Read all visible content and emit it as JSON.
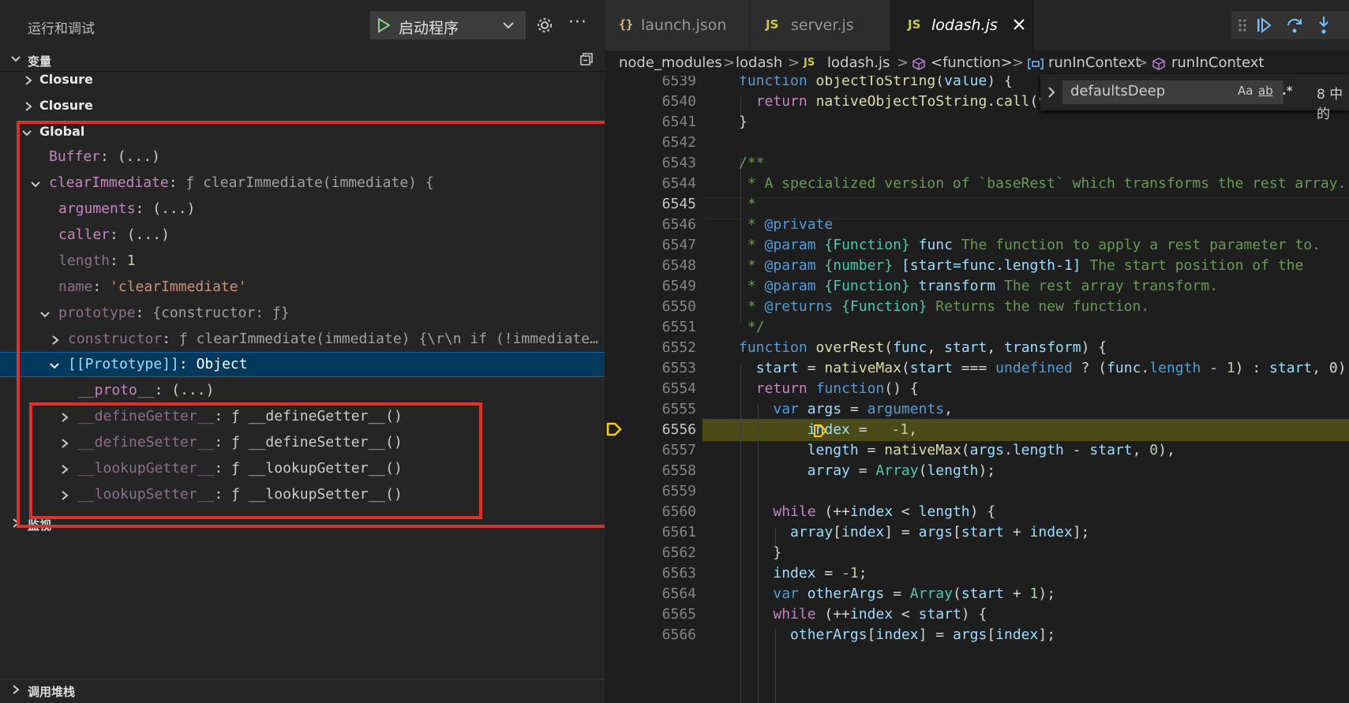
{
  "debug": {
    "title": "运行和调试",
    "launch_config": "启动程序",
    "more": "···"
  },
  "variables": {
    "header": "变量",
    "rows": [
      {
        "label": "Closure"
      },
      {
        "label": "Closure"
      },
      {
        "label": "Global"
      },
      {
        "key": "Buffer",
        "sep": ": ",
        "value": "(...)"
      },
      {
        "key": "clearImmediate",
        "sep": ": ",
        "value": "ƒ clearImmediate(immediate) {"
      },
      {
        "key": "arguments",
        "sep": ": ",
        "value": "(...)"
      },
      {
        "key": "caller",
        "sep": ": ",
        "value": "(...)"
      },
      {
        "key": "length",
        "sep": ": ",
        "value": "1"
      },
      {
        "key": "name",
        "sep": ": ",
        "value": "'clearImmediate'"
      },
      {
        "key": "prototype",
        "sep": ": ",
        "value": "{constructor: ƒ}"
      },
      {
        "key": "constructor",
        "sep": ": ",
        "value": "ƒ clearImmediate(immediate) {\\r\\n  if (!immediate…"
      },
      {
        "key": "[[Prototype]]",
        "sep": ": ",
        "value": "Object"
      },
      {
        "key": "__proto__",
        "sep": ": ",
        "value": "(...)"
      },
      {
        "key": "__defineGetter__",
        "sep": ": ",
        "value": "ƒ __defineGetter__()"
      },
      {
        "key": "__defineSetter__",
        "sep": ": ",
        "value": "ƒ __defineSetter__()"
      },
      {
        "key": "__lookupGetter__",
        "sep": ": ",
        "value": "ƒ __lookupGetter__()"
      },
      {
        "key": "__lookupSetter__",
        "sep": ": ",
        "value": "ƒ __lookupSetter__()"
      }
    ]
  },
  "watch": {
    "header": "监视"
  },
  "callstack": {
    "header": "调用堆栈"
  },
  "tabs": [
    {
      "icon": "{}",
      "label": "launch.json"
    },
    {
      "icon": "JS",
      "label": "server.js"
    },
    {
      "icon": "JS",
      "label": "lodash.js"
    }
  ],
  "breadcrumb": [
    "node_modules",
    "lodash",
    "lodash.js",
    "<function>",
    "runInContext",
    "runInContext"
  ],
  "find": {
    "value": "defaultsDeep",
    "count": "8 中的",
    "opt_case": "Aa",
    "opt_word": "ab",
    "opt_regex": ".*"
  },
  "editor": {
    "line_numbers": [
      "6539",
      "6540",
      "6541",
      "6542",
      "6543",
      "6544",
      "6545",
      "6546",
      "6547",
      "6548",
      "6549",
      "6550",
      "6551",
      "6552",
      "6553",
      "6554",
      "6555",
      "6556",
      "6557",
      "6558",
      "6559",
      "6560",
      "6561",
      "6562",
      "6563",
      "6564",
      "6565",
      "6566"
    ],
    "current_line": "6545",
    "exec_line": "6556"
  },
  "colors": {
    "accent": "#007acc",
    "highlight": "#e0302b",
    "exec": "#ffcc00"
  }
}
